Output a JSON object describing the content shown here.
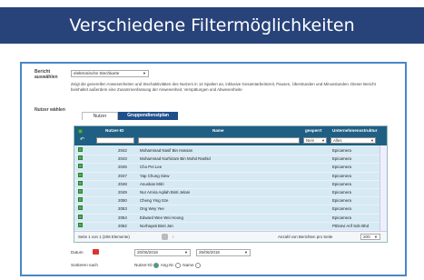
{
  "banner": {
    "title": "Verschiedene Filtermöglichkeiten"
  },
  "report": {
    "label": "Bericht auswählen",
    "selected": "elektronische Stechkarte",
    "description": "Zeigt die generellen Anwesenheiten und Stechaktivitäten des Nutzers in 14 Spalten an, inklusive Gesamtarbeitszeit, Pausen, Überstunden und Minusstunden. Dieser Bericht beinhaltet außerdem eine Zusammenfassung der Anwesenheit, Verspätungen und Abwesenheite"
  },
  "users": {
    "label": "Nutzer wählen",
    "tabs": [
      "Nutzer",
      "Gruppendienstplan"
    ]
  },
  "grid": {
    "headers": [
      "Nutzer-ID",
      "Name",
      "gesperrt",
      "Unternehmensstruktur"
    ],
    "filter_locked": "Nein",
    "filter_struct": "Alles",
    "rows": [
      {
        "id": "2042",
        "name": "Mohammad Nasif Bin Hassan",
        "struct": "Epicamera"
      },
      {
        "id": "2043",
        "name": "Mohammad Nurhizam Bin Mohd Rashid",
        "struct": "Epicamera"
      },
      {
        "id": "2045",
        "name": "Cho Pei Lee",
        "struct": "Epicamera"
      },
      {
        "id": "2047",
        "name": "Yap Chung Siew",
        "struct": "Epicamera"
      },
      {
        "id": "2048",
        "name": "Anuskan Mitri",
        "struct": "Epicamera"
      },
      {
        "id": "2049",
        "name": "Nur Amira Aqilah Binti Jelani",
        "struct": "Epicamera"
      },
      {
        "id": "2050",
        "name": "Cheng Ying Sze",
        "struct": "Epicamera"
      },
      {
        "id": "2053",
        "name": "Ong Wey Yee",
        "struct": "Epicamera"
      },
      {
        "id": "2054",
        "name": "Edward Wee Wei Hoong",
        "struct": "Epicamera"
      },
      {
        "id": "2062",
        "name": "Norhayati Binti Jan",
        "struct": "PtDarvi Arif Sdn Bhd"
      }
    ],
    "footer_left": "Seite 1 von 1 (206 Elemente)",
    "footer_right": "Anzahl von Berichten pro Seite",
    "per_page": "200"
  },
  "date": {
    "label": "Datum",
    "from": "20/06/2016",
    "to": "26/06/2016"
  },
  "sort": {
    "label": "Sortieren nach",
    "opt1": "Nutzer-ID",
    "opt2": "Ang.Nr.",
    "opt3": "Name"
  }
}
